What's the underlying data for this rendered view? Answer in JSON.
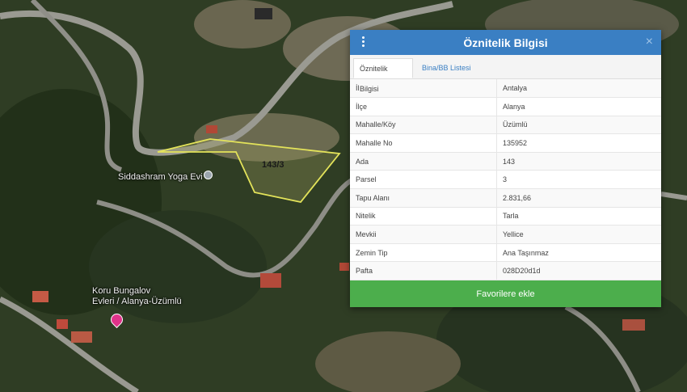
{
  "map": {
    "parcel_label": "143/3",
    "places": [
      {
        "name": "Siddashram Yoga Evi"
      },
      {
        "name": "Koru Bungalov\nEvleri / Alanya-Üzümlü"
      }
    ]
  },
  "panel": {
    "title": "Öznitelik Bilgisi",
    "close": "×",
    "tabs": [
      "Öznitelik Bilgisi",
      "Bina/BB Listesi"
    ],
    "rows": [
      {
        "key": "İl",
        "value": "Antalya"
      },
      {
        "key": "İlçe",
        "value": "Alanya"
      },
      {
        "key": "Mahalle/Köy",
        "value": "Üzümlü"
      },
      {
        "key": "Mahalle No",
        "value": "135952"
      },
      {
        "key": "Ada",
        "value": "143"
      },
      {
        "key": "Parsel",
        "value": "3"
      },
      {
        "key": "Tapu Alanı",
        "value": "2.831,66"
      },
      {
        "key": "Nitelik",
        "value": "Tarla"
      },
      {
        "key": "Mevkii",
        "value": "Yellice"
      },
      {
        "key": "Zemin Tip",
        "value": "Ana Taşınmaz"
      },
      {
        "key": "Pafta",
        "value": "028D20d1d"
      }
    ],
    "favorite_button": "Favorilere ekle"
  }
}
